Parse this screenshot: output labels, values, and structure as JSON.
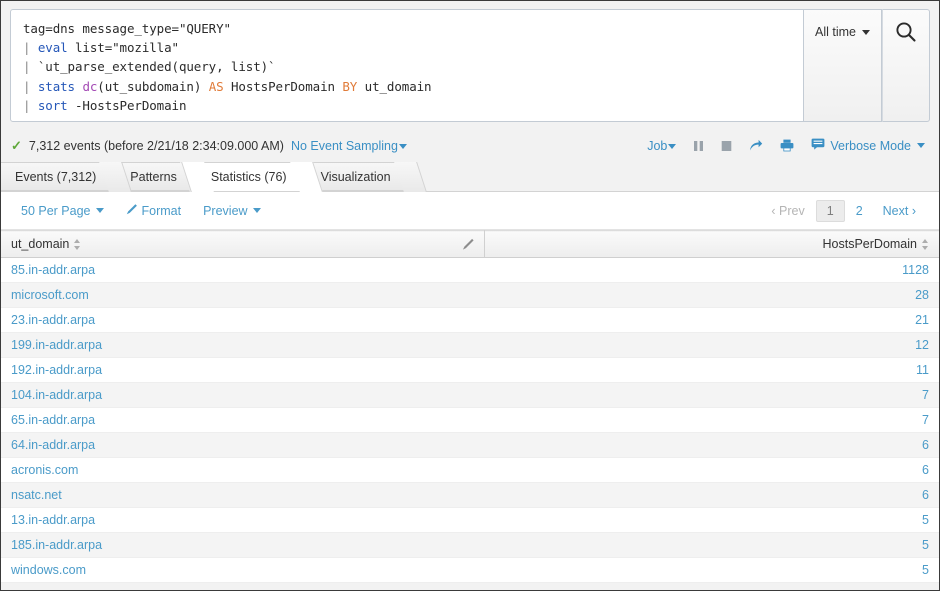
{
  "search": {
    "query_lines": [
      [
        {
          "t": "tag=dns message_type=\"QUERY\"",
          "c": "plain"
        }
      ],
      [
        {
          "t": "| ",
          "c": "pipe"
        },
        {
          "t": "eval",
          "c": "cmd"
        },
        {
          "t": " list=\"mozilla\"",
          "c": "plain"
        }
      ],
      [
        {
          "t": "| ",
          "c": "pipe"
        },
        {
          "t": "`ut_parse_extended(query, list)`",
          "c": "plain"
        }
      ],
      [
        {
          "t": "| ",
          "c": "pipe"
        },
        {
          "t": "stats",
          "c": "cmd"
        },
        {
          "t": " ",
          "c": "plain"
        },
        {
          "t": "dc",
          "c": "func"
        },
        {
          "t": "(ut_subdomain) ",
          "c": "plain"
        },
        {
          "t": "AS",
          "c": "kw"
        },
        {
          "t": " HostsPerDomain ",
          "c": "plain"
        },
        {
          "t": "BY",
          "c": "kw"
        },
        {
          "t": " ut_domain",
          "c": "plain"
        }
      ],
      [
        {
          "t": "| ",
          "c": "pipe"
        },
        {
          "t": "sort",
          "c": "cmd"
        },
        {
          "t": " -HostsPerDomain",
          "c": "plain"
        }
      ]
    ],
    "time_range_label": "All time",
    "search_icon": "search-icon"
  },
  "jobbar": {
    "status_check": "✓",
    "event_count_text": "7,312 events (before 2/21/18 2:34:09.000 AM)",
    "sampling_label": "No Event Sampling",
    "job_label": "Job",
    "pause_icon": "pause-icon",
    "stop_icon": "stop-icon",
    "share_icon": "share-icon",
    "print_icon": "print-icon",
    "mode_label": "Verbose Mode",
    "mode_icon": "comment-icon"
  },
  "tabs": [
    {
      "label": "Events (7,312)",
      "active": false
    },
    {
      "label": "Patterns",
      "active": false
    },
    {
      "label": "Statistics (76)",
      "active": true
    },
    {
      "label": "Visualization",
      "active": false
    }
  ],
  "results_toolbar": {
    "per_page_label": "50 Per Page",
    "format_label": "Format",
    "format_icon": "pencil-icon",
    "preview_label": "Preview"
  },
  "pagination": {
    "prev_label": "Prev",
    "next_label": "Next",
    "pages": [
      "1",
      "2"
    ],
    "current_page": "1"
  },
  "table": {
    "columns": [
      {
        "name": "ut_domain",
        "align": "left"
      },
      {
        "name": "HostsPerDomain",
        "align": "right"
      }
    ],
    "edit_icon": "pencil-icon",
    "rows": [
      {
        "ut_domain": "85.in-addr.arpa",
        "HostsPerDomain": "1128"
      },
      {
        "ut_domain": "microsoft.com",
        "HostsPerDomain": "28"
      },
      {
        "ut_domain": "23.in-addr.arpa",
        "HostsPerDomain": "21"
      },
      {
        "ut_domain": "199.in-addr.arpa",
        "HostsPerDomain": "12"
      },
      {
        "ut_domain": "192.in-addr.arpa",
        "HostsPerDomain": "11"
      },
      {
        "ut_domain": "104.in-addr.arpa",
        "HostsPerDomain": "7"
      },
      {
        "ut_domain": "65.in-addr.arpa",
        "HostsPerDomain": "7"
      },
      {
        "ut_domain": "64.in-addr.arpa",
        "HostsPerDomain": "6"
      },
      {
        "ut_domain": "acronis.com",
        "HostsPerDomain": "6"
      },
      {
        "ut_domain": "nsatc.net",
        "HostsPerDomain": "6"
      },
      {
        "ut_domain": "13.in-addr.arpa",
        "HostsPerDomain": "5"
      },
      {
        "ut_domain": "185.in-addr.arpa",
        "HostsPerDomain": "5"
      },
      {
        "ut_domain": "windows.com",
        "HostsPerDomain": "5"
      }
    ]
  },
  "colors": {
    "link": "#4a9bc9",
    "accent": "#3a8fc4",
    "success": "#5fa83a",
    "command": "#2557b8",
    "function": "#a44ab5",
    "keyword": "#e07b39",
    "page_bg": "#f2f2f2"
  }
}
